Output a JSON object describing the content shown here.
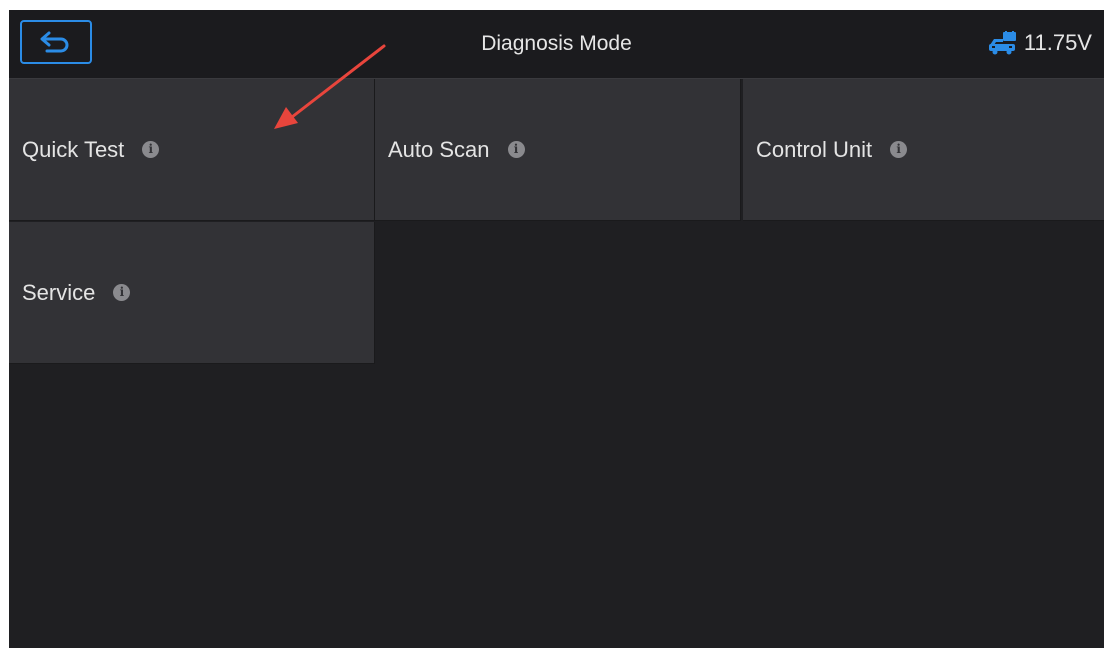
{
  "header": {
    "title": "Diagnosis Mode",
    "voltage": "11.75V",
    "back_icon": "back-arrow-icon",
    "battery_icon": "vehicle-battery-icon"
  },
  "tiles": [
    {
      "label": "Quick Test",
      "info_glyph": "i"
    },
    {
      "label": "Auto Scan",
      "info_glyph": "i"
    },
    {
      "label": "Control Unit",
      "info_glyph": "i"
    },
    {
      "label": "Service",
      "info_glyph": "i"
    }
  ],
  "colors": {
    "accent": "#2b8ce6",
    "annotation_arrow": "#e8453c",
    "tile_background": "#323236",
    "screen_background": "#1f1f22"
  }
}
